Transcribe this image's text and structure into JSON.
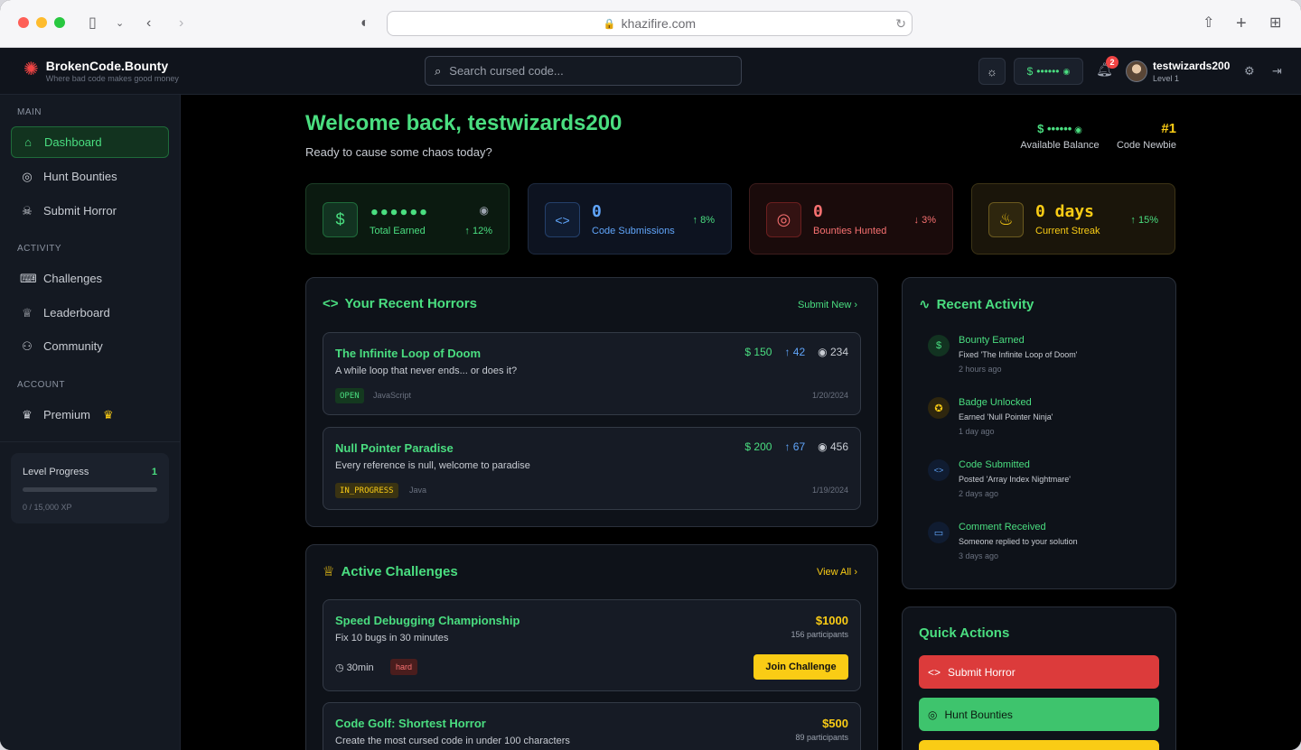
{
  "browser": {
    "url": "khazifire.com"
  },
  "app": {
    "name": "BrokenCode.Bounty",
    "tagline": "Where bad code makes good money"
  },
  "header": {
    "search_placeholder": "Search cursed code...",
    "balance_masked": "••••••",
    "notification_count": "2",
    "user": {
      "name": "testwizards200",
      "level": "Level 1"
    }
  },
  "sidebar": {
    "sections": {
      "main": "MAIN",
      "activity": "ACTIVITY",
      "account": "ACCOUNT"
    },
    "items": {
      "dashboard": "Dashboard",
      "hunt": "Hunt Bounties",
      "submit": "Submit Horror",
      "challenges": "Challenges",
      "leaderboard": "Leaderboard",
      "community": "Community",
      "premium": "Premium"
    },
    "level_progress": {
      "title": "Level Progress",
      "level": "1",
      "xp": "0 / 15,000 XP",
      "fraction": 0
    }
  },
  "main": {
    "welcome": "Welcome back, testwizards200",
    "subtitle": "Ready to cause some chaos today?",
    "balance": {
      "value": "••••••",
      "label": "Available Balance"
    },
    "rank": {
      "value": "#1",
      "label": "Code Newbie"
    },
    "stats": [
      {
        "value": "••••••",
        "label": "Total Earned",
        "change": "12%"
      },
      {
        "value": "0",
        "label": "Code Submissions",
        "change": "8%"
      },
      {
        "value": "0",
        "label": "Bounties Hunted",
        "change": "3%"
      },
      {
        "value": "0 days",
        "label": "Current Streak",
        "change": "15%"
      }
    ],
    "recent_horrors": {
      "title": "Your Recent Horrors",
      "link": "Submit New",
      "items": [
        {
          "title": "The Infinite Loop of Doom",
          "desc": "A while loop that never ends... or does it?",
          "bounty": "150",
          "votes": "42",
          "views": "234",
          "status": "OPEN",
          "language": "JavaScript",
          "date": "1/20/2024"
        },
        {
          "title": "Null Pointer Paradise",
          "desc": "Every reference is null, welcome to paradise",
          "bounty": "200",
          "votes": "67",
          "views": "456",
          "status": "IN_PROGRESS",
          "language": "Java",
          "date": "1/19/2024"
        }
      ]
    },
    "active_challenges": {
      "title": "Active Challenges",
      "link": "View All",
      "items": [
        {
          "title": "Speed Debugging Championship",
          "desc": "Fix 10 bugs in 30 minutes",
          "reward": "$1000",
          "participants": "156 participants",
          "duration": "30min",
          "difficulty": "hard",
          "button": "Join Challenge"
        },
        {
          "title": "Code Golf: Shortest Horror",
          "desc": "Create the most cursed code in under 100 characters",
          "reward": "$500",
          "participants": "89 participants"
        }
      ]
    },
    "recent_activity": {
      "title": "Recent Activity",
      "items": [
        {
          "title": "Bounty Earned",
          "desc": "Fixed 'The Infinite Loop of Doom'",
          "time": "2 hours ago"
        },
        {
          "title": "Badge Unlocked",
          "desc": "Earned 'Null Pointer Ninja'",
          "time": "1 day ago"
        },
        {
          "title": "Code Submitted",
          "desc": "Posted 'Array Index Nightmare'",
          "time": "2 days ago"
        },
        {
          "title": "Comment Received",
          "desc": "Someone replied to your solution",
          "time": "3 days ago"
        }
      ]
    },
    "quick_actions": {
      "title": "Quick Actions",
      "items": [
        {
          "label": "Submit Horror",
          "color": "#dc3b3b"
        },
        {
          "label": "Hunt Bounties",
          "color": "#3ec46d"
        },
        {
          "label": "",
          "color": "#facc15"
        }
      ]
    }
  },
  "colors": {
    "accent_green": "#4ade80",
    "accent_yellow": "#facc15",
    "accent_red": "#ef4444",
    "accent_blue": "#60a5fa"
  }
}
